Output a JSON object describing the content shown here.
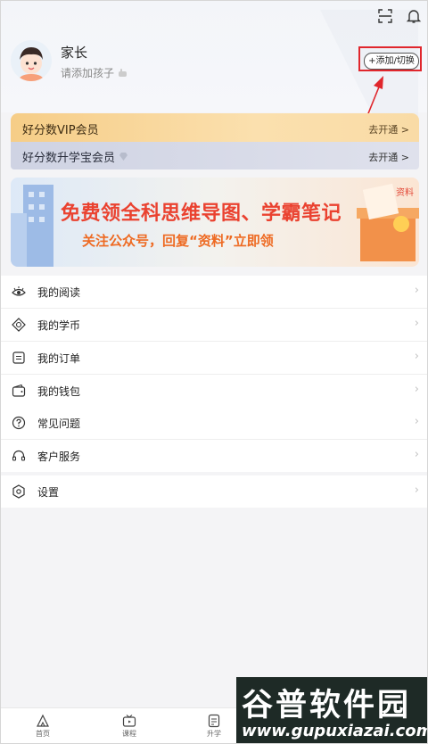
{
  "profile": {
    "name": "家长",
    "add_child": "请添加孩子",
    "switch_button": "+添加/切换"
  },
  "membership": {
    "vip_label": "好分数VIP会员",
    "vip_action": "去开通 >",
    "bao_label": "好分数升学宝会员",
    "bao_action": "去开通 >"
  },
  "banner": {
    "headline": "免费领全科思维导图、学霸笔记",
    "sub": "关注公众号，回复“资料”立即领"
  },
  "menu_group_1": [
    {
      "label": "我的阅读",
      "icon": "eye-icon"
    },
    {
      "label": "我的学币",
      "icon": "coin-icon"
    },
    {
      "label": "我的订单",
      "icon": "order-icon"
    },
    {
      "label": "我的钱包",
      "icon": "wallet-icon"
    }
  ],
  "menu_group_2": [
    {
      "label": "常见问题",
      "icon": "question-icon"
    },
    {
      "label": "客户服务",
      "icon": "headset-icon"
    }
  ],
  "menu_group_3": [
    {
      "label": "设置",
      "icon": "settings-icon"
    }
  ],
  "tabs": [
    {
      "label": "首页",
      "icon": "home-icon"
    },
    {
      "label": "课程",
      "icon": "tv-icon"
    },
    {
      "label": "升学",
      "icon": "document-icon"
    }
  ],
  "watermark": {
    "brand": "谷普软件园",
    "url": "www.gupuxiazai.com"
  },
  "colors": {
    "annotation_red": "#e0262c",
    "banner_red": "#ea4230",
    "vip_gold": "#f6cd87"
  }
}
